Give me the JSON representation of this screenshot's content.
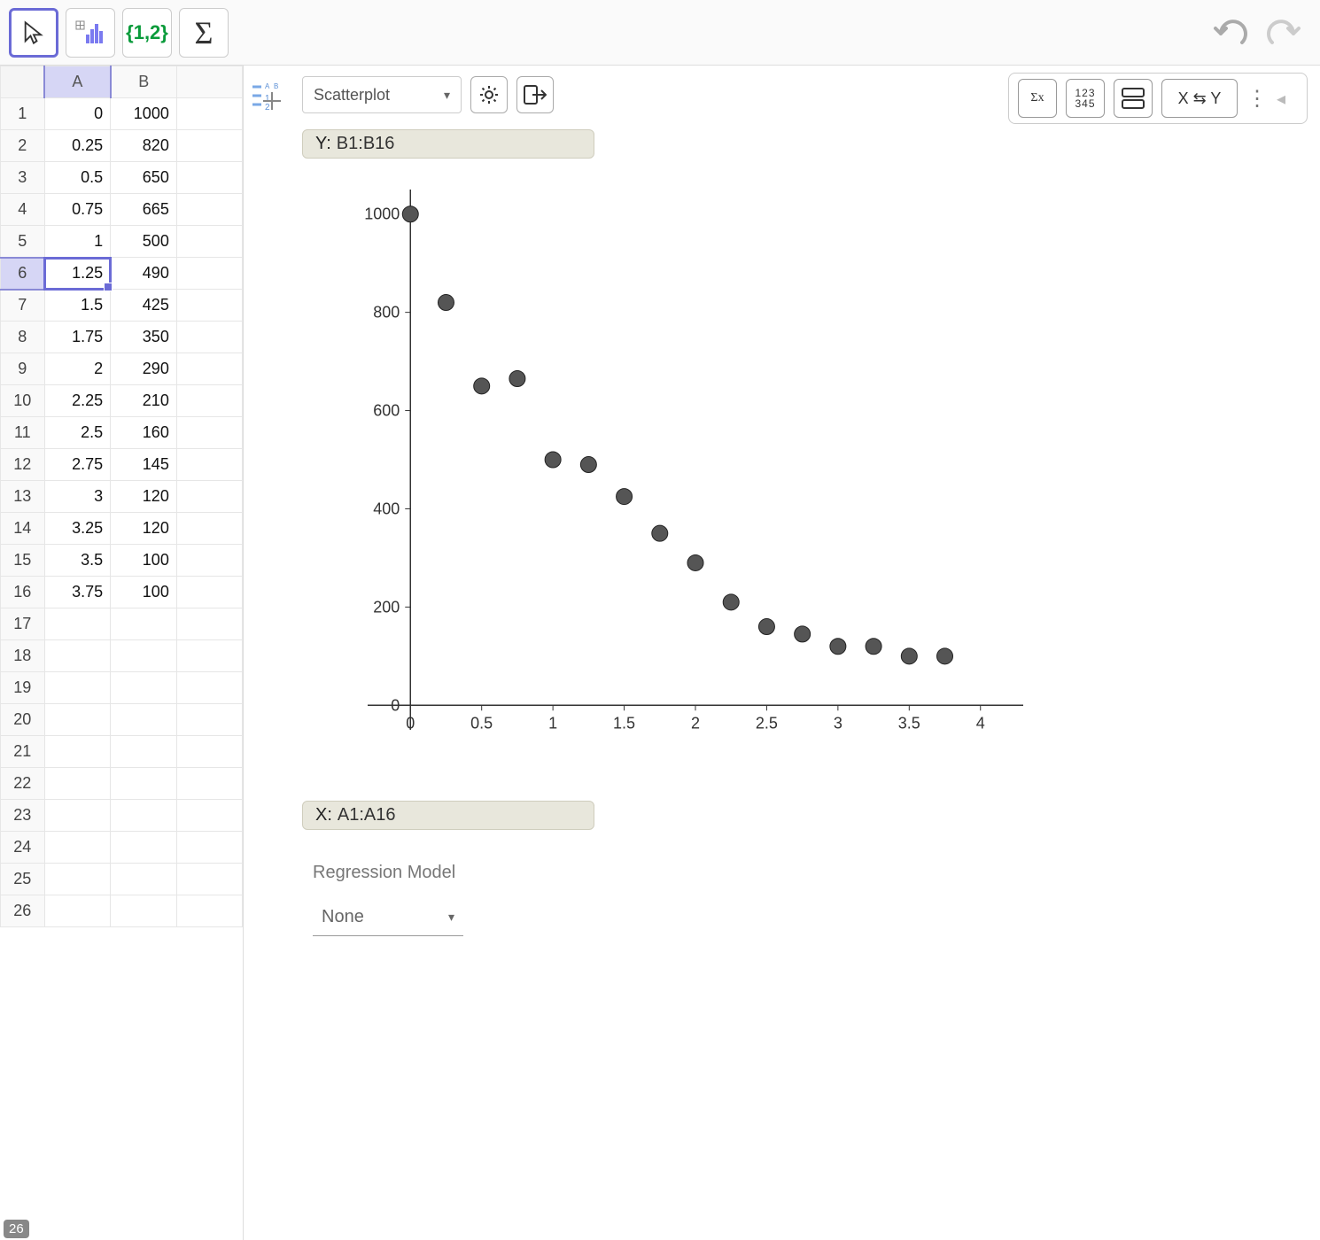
{
  "toolbar": {
    "move_icon": "cursor-icon",
    "chart_icon": "bar-chart-icon",
    "list_label": "{1,2}",
    "sigma_label": "Σ"
  },
  "spreadsheet": {
    "columns": [
      "A",
      "B"
    ],
    "selected_cell": "A6",
    "selected_row": 6,
    "selected_col": "A",
    "row_input_label": "26",
    "row_count": 26,
    "rows": [
      {
        "n": 1,
        "A": "0",
        "B": "1000"
      },
      {
        "n": 2,
        "A": "0.25",
        "B": "820"
      },
      {
        "n": 3,
        "A": "0.5",
        "B": "650"
      },
      {
        "n": 4,
        "A": "0.75",
        "B": "665"
      },
      {
        "n": 5,
        "A": "1",
        "B": "500"
      },
      {
        "n": 6,
        "A": "1.25",
        "B": "490"
      },
      {
        "n": 7,
        "A": "1.5",
        "B": "425"
      },
      {
        "n": 8,
        "A": "1.75",
        "B": "350"
      },
      {
        "n": 9,
        "A": "2",
        "B": "290"
      },
      {
        "n": 10,
        "A": "2.25",
        "B": "210"
      },
      {
        "n": 11,
        "A": "2.5",
        "B": "160"
      },
      {
        "n": 12,
        "A": "2.75",
        "B": "145"
      },
      {
        "n": 13,
        "A": "3",
        "B": "120"
      },
      {
        "n": 14,
        "A": "3.25",
        "B": "120"
      },
      {
        "n": 15,
        "A": "3.5",
        "B": "100"
      },
      {
        "n": 16,
        "A": "3.75",
        "B": "100"
      },
      {
        "n": 17,
        "A": "",
        "B": ""
      },
      {
        "n": 18,
        "A": "",
        "B": ""
      },
      {
        "n": 19,
        "A": "",
        "B": ""
      },
      {
        "n": 20,
        "A": "",
        "B": ""
      },
      {
        "n": 21,
        "A": "",
        "B": ""
      },
      {
        "n": 22,
        "A": "",
        "B": ""
      },
      {
        "n": 23,
        "A": "",
        "B": ""
      },
      {
        "n": 24,
        "A": "",
        "B": ""
      },
      {
        "n": 25,
        "A": "",
        "B": ""
      },
      {
        "n": 26,
        "A": "",
        "B": ""
      }
    ]
  },
  "chart_toolbar": {
    "plot_type": "Scatterplot",
    "swap_label": "X ⇆ Y",
    "stats_icon_label": "Σx",
    "numfmt_icon_top": "123",
    "numfmt_icon_bot": "345"
  },
  "ranges": {
    "y_prefix": "Y:",
    "y_range": "B1:B16",
    "x_prefix": "X:",
    "x_range": "A1:A16"
  },
  "regression": {
    "section_label": "Regression Model",
    "selected": "None"
  },
  "chart_data": {
    "type": "scatter",
    "x": [
      0,
      0.25,
      0.5,
      0.75,
      1,
      1.25,
      1.5,
      1.75,
      2,
      2.25,
      2.5,
      2.75,
      3,
      3.25,
      3.5,
      3.75
    ],
    "y": [
      1000,
      820,
      650,
      665,
      500,
      490,
      425,
      350,
      290,
      210,
      160,
      145,
      120,
      120,
      100,
      100
    ],
    "xlabel": "",
    "ylabel": "",
    "xlim": [
      -0.3,
      4.3
    ],
    "ylim": [
      -50,
      1050
    ],
    "x_ticks": [
      0,
      0.5,
      1,
      1.5,
      2,
      2.5,
      3,
      3.5,
      4
    ],
    "y_ticks": [
      0,
      200,
      400,
      600,
      800,
      1000
    ],
    "title": ""
  }
}
